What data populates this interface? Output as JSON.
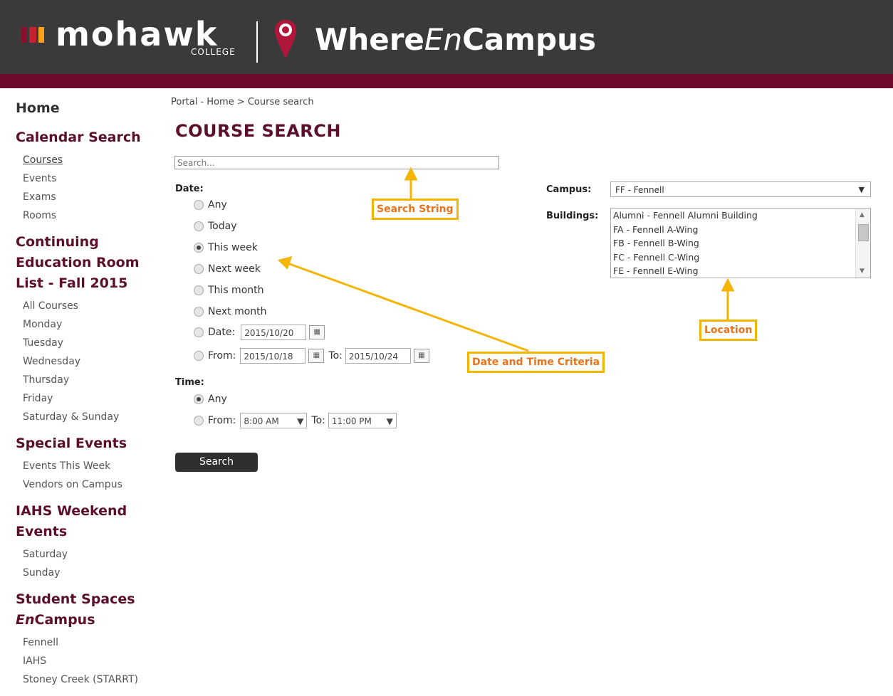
{
  "header": {
    "brand": "mohawk",
    "brand_sub": "COLLEGE",
    "app_name_part1": "Where",
    "app_name_part2": "En",
    "app_name_part3": "Campus"
  },
  "sidebar": {
    "home": "Home",
    "sections": [
      {
        "title": "Calendar Search",
        "items": [
          "Courses",
          "Events",
          "Exams",
          "Rooms"
        ]
      },
      {
        "title": "Continuing Education Room List - Fall 2015",
        "items": [
          "All Courses",
          "Monday",
          "Tuesday",
          "Wednesday",
          "Thursday",
          "Friday",
          "Saturday & Sunday"
        ]
      },
      {
        "title": "Special Events",
        "items": [
          "Events This Week",
          "Vendors on Campus"
        ]
      },
      {
        "title": "IAHS Weekend Events",
        "items": [
          "Saturday",
          "Sunday"
        ]
      },
      {
        "title_part1": "Student Spaces",
        "title_part2": "En",
        "title_part3": "Campus",
        "items": [
          "Fennell",
          "IAHS",
          "Stoney Creek (STARRT)"
        ]
      }
    ]
  },
  "main": {
    "breadcrumb": "Portal - Home > Course search",
    "title": "COURSE SEARCH",
    "search_placeholder": "Search...",
    "date_label": "Date:",
    "date_options": [
      "Any",
      "Today",
      "This week",
      "Next week",
      "This month",
      "Next month"
    ],
    "date_selected": "This week",
    "date_field_label": "Date:",
    "date_value": "2015/10/20",
    "from_label": "From:",
    "from_value": "2015/10/18",
    "to_label": "To:",
    "to_value": "2015/10/24",
    "time_label": "Time:",
    "time_any": "Any",
    "time_from_label": "From:",
    "time_from_value": "8:00 AM",
    "time_to_label": "To:",
    "time_to_value": "11:00 PM",
    "search_button": "Search",
    "campus_label": "Campus:",
    "campus_value": "FF - Fennell",
    "buildings_label": "Buildings:",
    "buildings": [
      "Alumni - Fennell Alumni Building",
      "FA - Fennell A-Wing",
      "FB - Fennell B-Wing",
      "FC - Fennell C-Wing",
      "FE - Fennell E-Wing"
    ]
  },
  "annotations": {
    "search_string": "Search String",
    "date_time": "Date and Time Criteria",
    "location": "Location",
    "color": "#f4b400",
    "text_color": "#e8731a"
  },
  "colors": {
    "header_bg": "#3a3a3a",
    "header_band": "#6e0b2d",
    "accent": "#5b0f2a"
  }
}
